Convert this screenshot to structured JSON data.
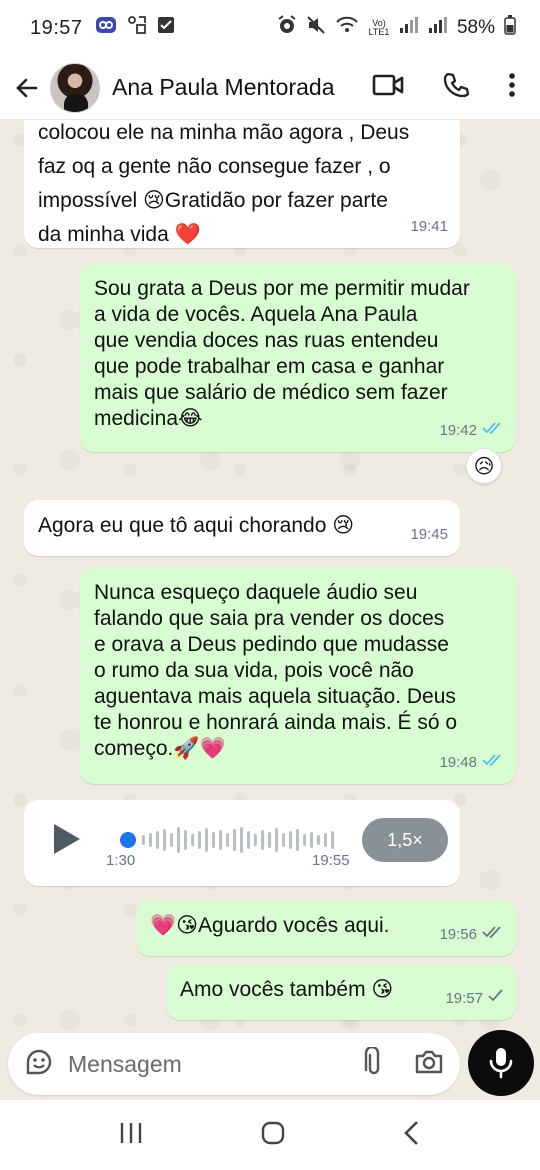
{
  "status_bar": {
    "time": "19:57",
    "battery": "58%",
    "network_label": "Vo) LTE1"
  },
  "header": {
    "back_icon": "arrow-left-icon",
    "contact_name": "Ana Paula Mentorada",
    "video_icon": "video-call-icon",
    "call_icon": "phone-icon",
    "menu_icon": "more-vert-icon"
  },
  "messages": [
    {
      "direction": "in",
      "text": "colocou ele na minha mão agora , Deus\nfaz oq a gente não consegue fazer , o\nimpossível 😢Gratidão por fazer parte\nda minha vida ❤️",
      "time": "19:41"
    },
    {
      "direction": "out",
      "text": "Sou grata a Deus por me permitir mudar\na vida de vocês. Aquela Ana Paula\nque vendia doces nas ruas entendeu\nque pode trabalhar em casa e ganhar\nmais que salário de médico sem fazer\nmedicina😂",
      "time": "19:42",
      "status": "read",
      "reaction": "😥"
    },
    {
      "direction": "in",
      "text": "Agora eu que tô aqui chorando 😢",
      "time": "19:45"
    },
    {
      "direction": "out",
      "text": "Nunca esqueço daquele áudio seu\nfalando que saia pra vender os doces\ne orava a Deus pedindo que mudasse\no rumo da sua vida, pois você não\naguentava mais aquela situação. Deus\nte honrou e honrará ainda mais. É só o\ncomeço.🚀💗",
      "time": "19:48",
      "status": "read"
    },
    {
      "direction": "in",
      "type": "audio",
      "duration": "1:30",
      "time": "19:55",
      "speed": "1,5×",
      "progress": 0
    },
    {
      "direction": "out",
      "text": "💗😘Aguardo vocês aqui.",
      "time": "19:56",
      "status": "delivered"
    },
    {
      "direction": "out",
      "text": "Amo vocês também 😘",
      "time": "19:57",
      "status": "sent"
    }
  ],
  "input": {
    "placeholder": "Mensagem",
    "emoji_icon": "sticker-emoji-icon",
    "attach_icon": "paperclip-icon",
    "camera_icon": "camera-icon",
    "mic_icon": "microphone-icon"
  },
  "nav": {
    "recents_icon": "recents-icon",
    "home_icon": "home-icon",
    "back_icon": "back-chevron-icon"
  },
  "colors": {
    "incoming_bubble": "#ffffff",
    "outgoing_bubble": "#d9fdd3",
    "read_ticks": "#53bdeb",
    "chat_background": "#efeae2"
  }
}
